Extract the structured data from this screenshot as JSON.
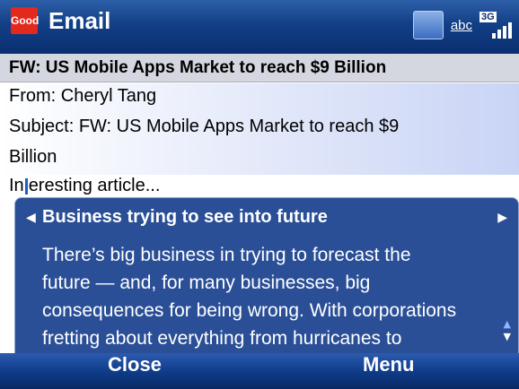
{
  "app": {
    "logo_text": "Good",
    "title": "Email"
  },
  "status": {
    "input_mode": "abc",
    "network": "3G"
  },
  "message": {
    "subject_bar": "FW: US Mobile Apps Market to reach $9 Billion",
    "from_line": "From: Cheryl Tang",
    "subject_line_1": "Subject: FW: US Mobile Apps Market to reach $9",
    "subject_line_2": "Billion",
    "body_start": "In",
    "body_rest": "eresting article..."
  },
  "popup": {
    "title": "Business trying to see into future",
    "lines": [
      "There’s big business in trying to forecast the",
      "future — and, for many businesses, big",
      "consequences for being wrong. With corporations",
      "fretting about everything from hurricanes to"
    ]
  },
  "softkeys": {
    "left": "Close",
    "right": "Menu"
  },
  "colors": {
    "title_bar": "#123f86",
    "popup_bg": "#2a4f97",
    "logo": "#e3281c"
  }
}
